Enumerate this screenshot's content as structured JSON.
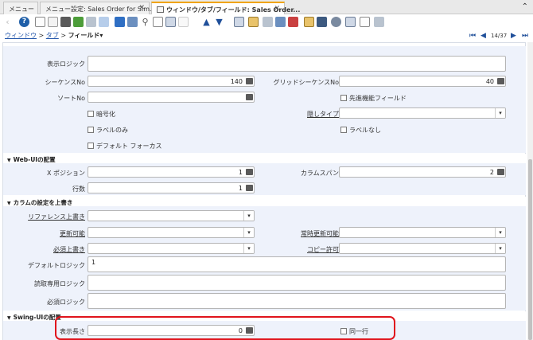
{
  "tabs": [
    {
      "label": "メニュー"
    },
    {
      "label": "メニュー設定: Sales Order for Sim..."
    },
    {
      "label": "ウィンドウ/タブ/フィールド: Sales Order..."
    }
  ],
  "breadcrumb": {
    "window": "ウィンドウ",
    "tab": "タブ",
    "current": "フィールド▾",
    "sep": ">"
  },
  "record_counter": "14/37",
  "fields": {
    "display_logic": {
      "label": "表示ロジック",
      "value": ""
    },
    "sequence": {
      "label": "シーケンスNo",
      "value": "140"
    },
    "grid_sequence": {
      "label": "グリッドシーケンスNo",
      "value": "40"
    },
    "sort_no": {
      "label": "ソートNo",
      "value": ""
    },
    "advanced_field": {
      "label": "先進機能フィールド"
    },
    "encrypted": {
      "label": "暗号化"
    },
    "obscure_type": {
      "label": "隠しタイプ",
      "value": ""
    },
    "label_only": {
      "label": "ラベルのみ"
    },
    "no_label": {
      "label": "ラベルなし"
    },
    "default_focus": {
      "label": "デフォルト フォーカス"
    }
  },
  "web_ui": {
    "title": "Web-UIの配置",
    "x_position": {
      "label": "X ポジション",
      "value": "1"
    },
    "column_span": {
      "label": "カラムスパン",
      "value": "2"
    },
    "rows": {
      "label": "行数",
      "value": "1"
    }
  },
  "column_override": {
    "title": "カラムの設定を上書き",
    "reference_override": {
      "label": "リファレンス上書き",
      "value": ""
    },
    "updatable": {
      "label": "更新可能",
      "value": ""
    },
    "always_updatable": {
      "label": "常時更新可能",
      "value": ""
    },
    "mandatory_override": {
      "label": "必須上書き",
      "value": ""
    },
    "copy_allowed": {
      "label": "コピー許可",
      "value": ""
    },
    "default_logic": {
      "label": "デフォルトロジック",
      "value": "1"
    },
    "readonly_logic": {
      "label": "読取専用ロジック",
      "value": ""
    },
    "mandatory_logic": {
      "label": "必須ロジック",
      "value": ""
    }
  },
  "swing_ui": {
    "title": "Swing-UIの配置",
    "display_length": {
      "label": "表示長さ",
      "value": "0"
    },
    "same_line": {
      "label": "同一行"
    }
  },
  "colors": {
    "accent_tab": "#f0a400",
    "band": "#eef2fb",
    "highlight": "#e0141c"
  }
}
